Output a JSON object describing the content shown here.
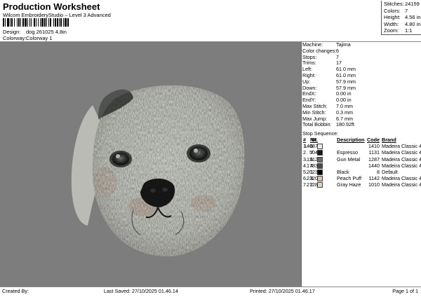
{
  "header": {
    "title": "Production Worksheet",
    "subtitle": "Wilcom EmbroideryStudio – Level 3 Advanced",
    "design_label": "Design:",
    "design_value": "dog 261025 4,8in",
    "colorway_label": "Colorway:",
    "colorway_value": "Colorway 1"
  },
  "summary": [
    {
      "key": "Stitches:",
      "value": "24159"
    },
    {
      "key": "Colors:",
      "value": "7"
    },
    {
      "key": "Height:",
      "value": "4.56 in"
    },
    {
      "key": "Width:",
      "value": "4.80 in"
    },
    {
      "key": "Zoom:",
      "value": "1:1"
    }
  ],
  "machine_info": [
    {
      "key": "Machine:",
      "value": "Tajima"
    },
    {
      "key": "Color changes:",
      "value": "6"
    },
    {
      "key": "Stops:",
      "value": "7"
    },
    {
      "key": "Trims:",
      "value": "17"
    },
    {
      "key": "Left:",
      "value": "61.0 mm"
    },
    {
      "key": "Right:",
      "value": "61.0 mm"
    },
    {
      "key": "Up:",
      "value": "57.9 mm"
    },
    {
      "key": "Down:",
      "value": "57.9 mm"
    },
    {
      "key": "EndX:",
      "value": "0.00 in"
    },
    {
      "key": "EndY:",
      "value": "0.00 in"
    },
    {
      "key": "Max Stitch:",
      "value": "7.0 mm"
    },
    {
      "key": "Min Stitch:",
      "value": "0.3 mm"
    },
    {
      "key": "Max Jump:",
      "value": "6.7 mm"
    },
    {
      "key": "Total Bobbin:",
      "value": "180.92ft"
    }
  ],
  "stop_sequence": {
    "title": "Stop Sequence:",
    "headers": {
      "num": "#",
      "n": "N#",
      "st": "St.",
      "desc": "Description",
      "code": "Code",
      "brand": "Brand"
    },
    "rows": [
      {
        "num": "1.",
        "n": "6",
        "color": "#e9ebe6",
        "st": "14087",
        "desc": "",
        "code": "1410",
        "brand": "Madeira Classic 40"
      },
      {
        "num": "2.",
        "n": "7",
        "color": "#1a1a1a",
        "st": "504",
        "desc": "Espresso",
        "code": "1131",
        "brand": "Madeira Classic 40"
      },
      {
        "num": "3.",
        "n": "6",
        "color": "#6b6b6b",
        "st": "1312",
        "desc": "Gun Metal",
        "code": "1287",
        "brand": "Madeira Classic 40"
      },
      {
        "num": "4.",
        "n": "4",
        "color": "#4a4a4a",
        "st": "1783",
        "desc": "",
        "code": "1440",
        "brand": "Madeira Classic 40"
      },
      {
        "num": "5.",
        "n": "1",
        "color": "#000000",
        "st": "2023",
        "desc": "Black",
        "code": "8",
        "brand": "Default"
      },
      {
        "num": "6.",
        "n": "3",
        "color": "#d8c1b0",
        "st": "2320",
        "desc": "Peach Puff",
        "code": "1142",
        "brand": "Madeira Classic 40"
      },
      {
        "num": "7.",
        "n": "2",
        "color": "#d6d6d2",
        "st": "2128",
        "desc": "Gray Haze",
        "code": "1010",
        "brand": "Madeira Classic 40"
      }
    ]
  },
  "footer": {
    "created_by": "Created By:",
    "last_saved": "Last Saved: 27/10/2025 01.46.14",
    "printed": "Printed: 27/10/2025 01.46.17",
    "page": "Page 1 of 1"
  },
  "canvas": {
    "background": "#7d7d7d"
  }
}
